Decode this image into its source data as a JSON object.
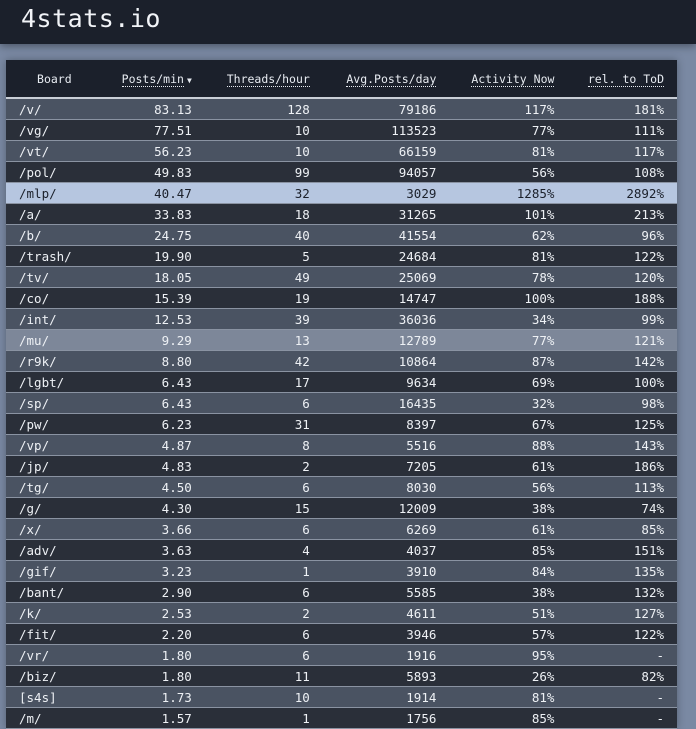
{
  "site": {
    "title": "4stats.io"
  },
  "table": {
    "headers": [
      "Board",
      "Posts/min",
      "Threads/hour",
      "Avg.Posts/day",
      "Activity Now",
      "rel. to ToD"
    ],
    "sort_indicator": "▼",
    "rows": [
      [
        "/v/",
        "83.13",
        "128",
        "79186",
        "117%",
        "181%"
      ],
      [
        "/vg/",
        "77.51",
        "10",
        "113523",
        "77%",
        "111%"
      ],
      [
        "/vt/",
        "56.23",
        "10",
        "66159",
        "81%",
        "117%"
      ],
      [
        "/pol/",
        "49.83",
        "99",
        "94057",
        "56%",
        "108%"
      ],
      [
        "/mlp/",
        "40.47",
        "32",
        "3029",
        "1285%",
        "2892%"
      ],
      [
        "/a/",
        "33.83",
        "18",
        "31265",
        "101%",
        "213%"
      ],
      [
        "/b/",
        "24.75",
        "40",
        "41554",
        "62%",
        "96%"
      ],
      [
        "/trash/",
        "19.90",
        "5",
        "24684",
        "81%",
        "122%"
      ],
      [
        "/tv/",
        "18.05",
        "49",
        "25069",
        "78%",
        "120%"
      ],
      [
        "/co/",
        "15.39",
        "19",
        "14747",
        "100%",
        "188%"
      ],
      [
        "/int/",
        "12.53",
        "39",
        "36036",
        "34%",
        "99%"
      ],
      [
        "/mu/",
        "9.29",
        "13",
        "12789",
        "77%",
        "121%"
      ],
      [
        "/r9k/",
        "8.80",
        "42",
        "10864",
        "87%",
        "142%"
      ],
      [
        "/lgbt/",
        "6.43",
        "17",
        "9634",
        "69%",
        "100%"
      ],
      [
        "/sp/",
        "6.43",
        "6",
        "16435",
        "32%",
        "98%"
      ],
      [
        "/pw/",
        "6.23",
        "31",
        "8397",
        "67%",
        "125%"
      ],
      [
        "/vp/",
        "4.87",
        "8",
        "5516",
        "88%",
        "143%"
      ],
      [
        "/jp/",
        "4.83",
        "2",
        "7205",
        "61%",
        "186%"
      ],
      [
        "/tg/",
        "4.50",
        "6",
        "8030",
        "56%",
        "113%"
      ],
      [
        "/g/",
        "4.30",
        "15",
        "12009",
        "38%",
        "74%"
      ],
      [
        "/x/",
        "3.66",
        "6",
        "6269",
        "61%",
        "85%"
      ],
      [
        "/adv/",
        "3.63",
        "4",
        "4037",
        "85%",
        "151%"
      ],
      [
        "/gif/",
        "3.23",
        "1",
        "3910",
        "84%",
        "135%"
      ],
      [
        "/bant/",
        "2.90",
        "6",
        "5585",
        "38%",
        "132%"
      ],
      [
        "/k/",
        "2.53",
        "2",
        "4611",
        "51%",
        "127%"
      ],
      [
        "/fit/",
        "2.20",
        "6",
        "3946",
        "57%",
        "122%"
      ],
      [
        "/vr/",
        "1.80",
        "6",
        "1916",
        "95%",
        "-"
      ],
      [
        "/biz/",
        "1.80",
        "11",
        "5893",
        "26%",
        "82%"
      ],
      [
        "[s4s]",
        "1.73",
        "10",
        "1914",
        "81%",
        "-"
      ],
      [
        "/m/",
        "1.57",
        "1",
        "1756",
        "85%",
        "-"
      ]
    ],
    "highlighted_rows": {
      "4": "hl",
      "11": "hl2"
    }
  }
}
